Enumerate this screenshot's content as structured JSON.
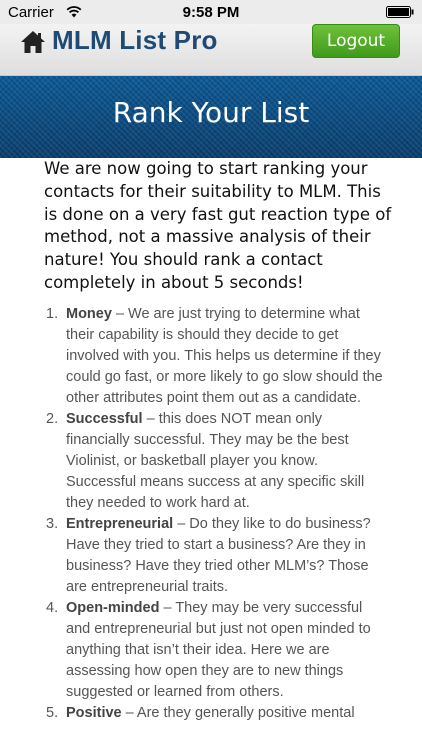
{
  "status_bar": {
    "carrier": "Carrier",
    "time": "9:58 PM",
    "wifi_icon": "wifi-icon",
    "battery_icon": "battery-icon"
  },
  "header": {
    "home_icon": "home-icon",
    "app_title": "MLM List Pro",
    "logout_label": "Logout",
    "logout_color": "#4fad27",
    "title_color": "#1f4a73"
  },
  "banner": {
    "title": "Rank Your List",
    "color": "#0c4e86"
  },
  "intro": "We are now going to start ranking your contacts for their suitability to MLM. This is done on a very fast gut reaction type of method, not a massive analysis of their nature! You should rank a contact completely in about 5 seconds!",
  "list": [
    {
      "number": "1.",
      "term": "Money",
      "text": " – We are just trying to determine what their capability is should they decide to get involved with you.  This helps us determine if they could go fast, or more likely to go slow should the other attributes point them out as a candidate."
    },
    {
      "number": "2.",
      "term": "Successful",
      "text": " – this does NOT mean only financially successful.  They may be the best Violinist, or basketball player you know. Successful means success at any specific skill they needed to work hard at."
    },
    {
      "number": "3.",
      "term": "Entrepreneurial",
      "text": " – Do they like to do business?  Have they tried to start a business?  Are they in business?  Have they tried other MLM’s?  Those are entrepreneurial traits."
    },
    {
      "number": "4.",
      "term": "Open-minded",
      "text": " – They may be very successful and entrepreneurial but just not open minded to anything that isn’t their idea.  Here we are assessing how open they are to new things suggested or learned from others."
    },
    {
      "number": "5.",
      "term": "Positive",
      "text": " – Are they generally positive mental"
    }
  ]
}
